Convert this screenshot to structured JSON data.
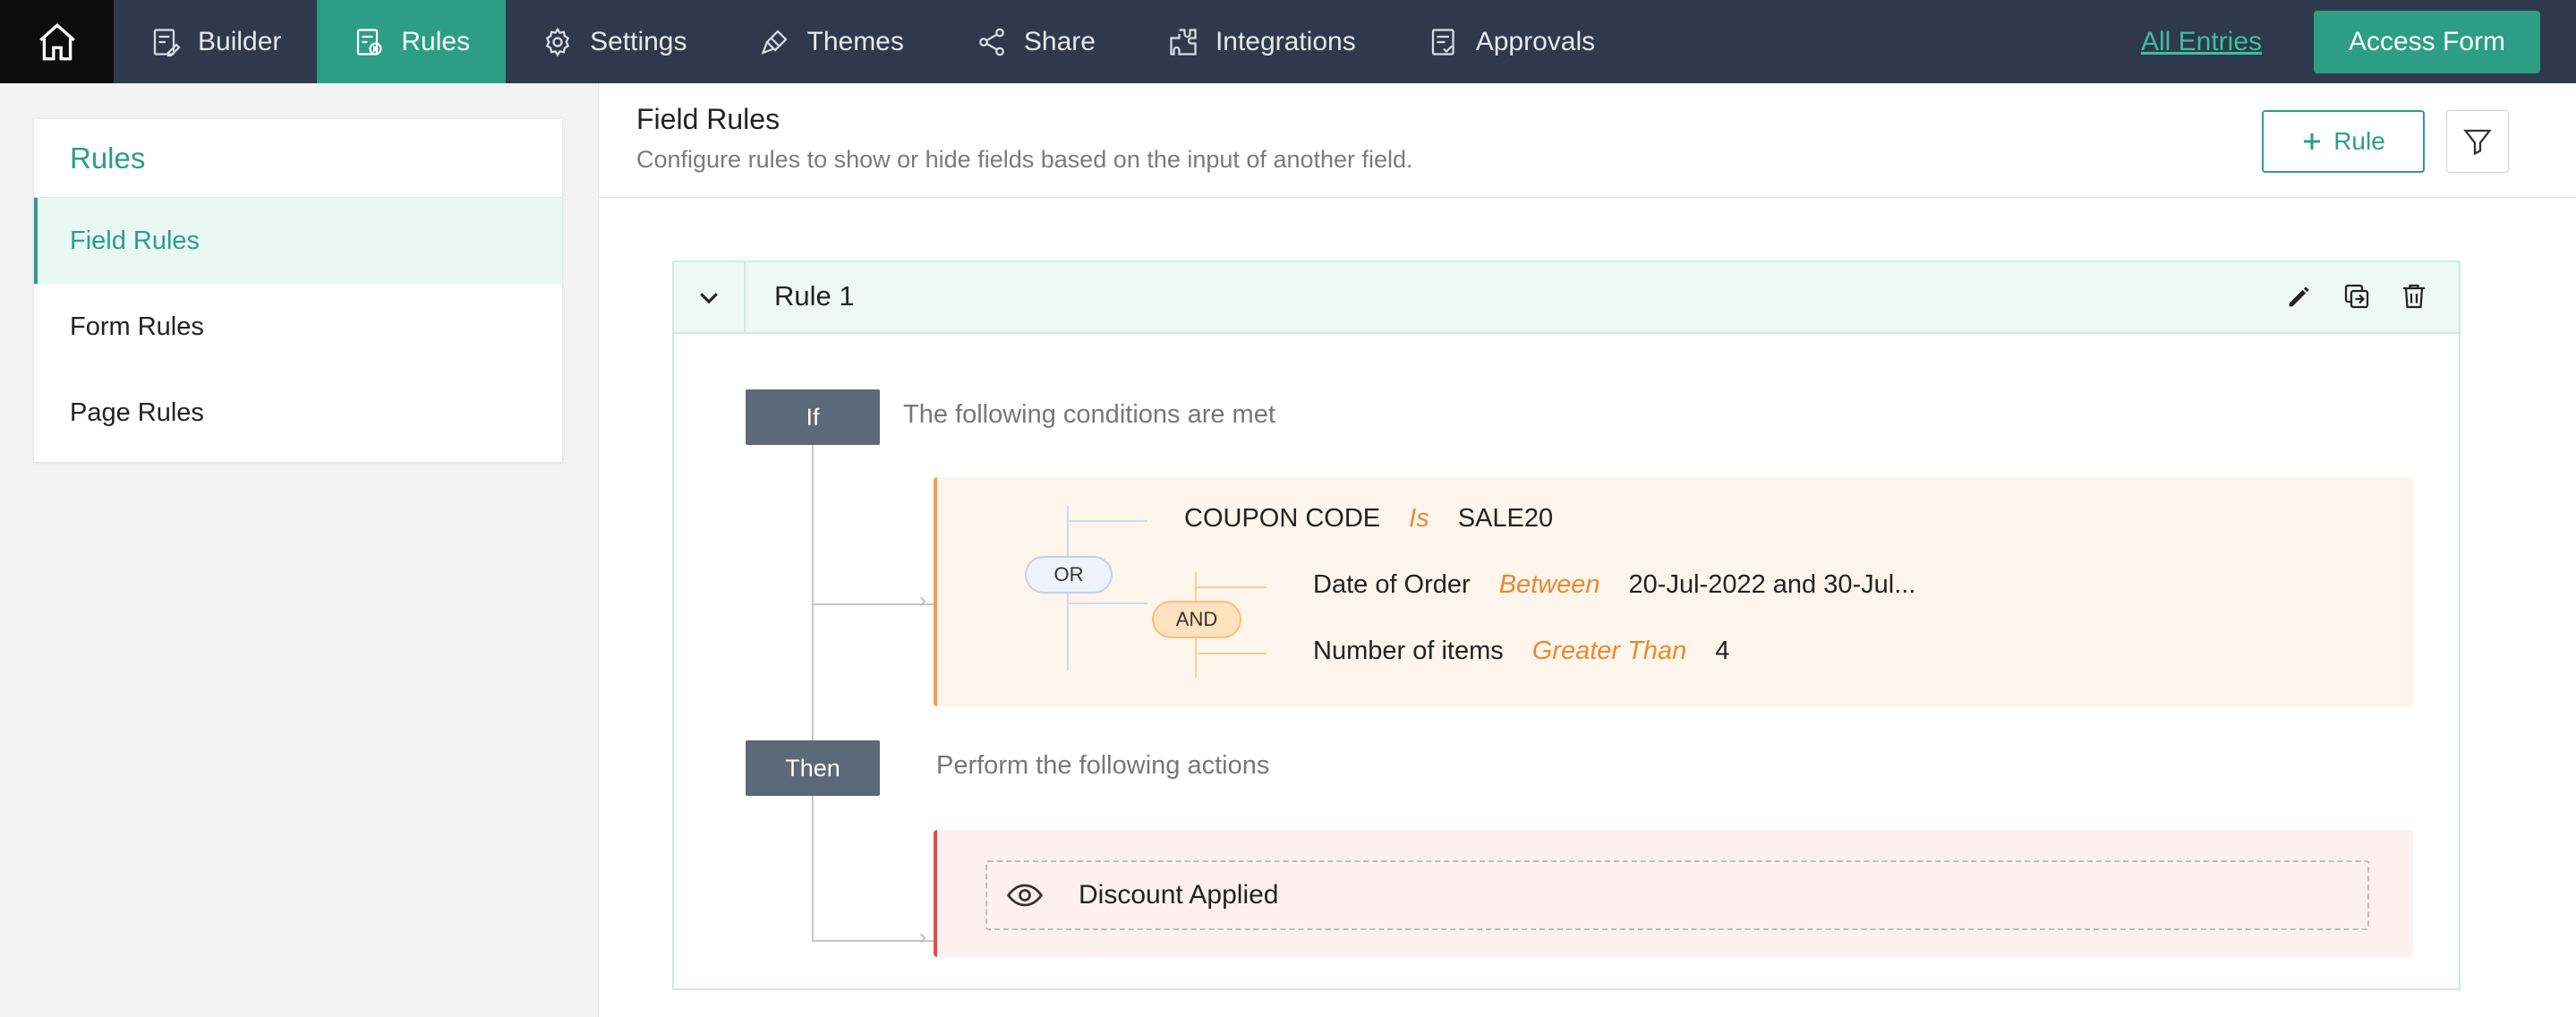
{
  "nav": {
    "items": [
      {
        "label": "Builder",
        "icon": "builder-icon",
        "active": false
      },
      {
        "label": "Rules",
        "icon": "rules-icon",
        "active": true
      },
      {
        "label": "Settings",
        "icon": "gear-icon",
        "active": false
      },
      {
        "label": "Themes",
        "icon": "brush-icon",
        "active": false
      },
      {
        "label": "Share",
        "icon": "share-icon",
        "active": false
      },
      {
        "label": "Integrations",
        "icon": "puzzle-icon",
        "active": false
      },
      {
        "label": "Approvals",
        "icon": "approvals-icon",
        "active": false
      }
    ],
    "all_entries": "All Entries",
    "access_form": "Access Form"
  },
  "sidebar": {
    "title": "Rules",
    "items": [
      {
        "label": "Field Rules",
        "active": true
      },
      {
        "label": "Form Rules",
        "active": false
      },
      {
        "label": "Page Rules",
        "active": false
      }
    ]
  },
  "header": {
    "title": "Field Rules",
    "subtitle": "Configure rules to show or hide fields based on the input of another field.",
    "add_rule_label": "Rule"
  },
  "rule": {
    "name": "Rule 1",
    "if_label": "If",
    "then_label": "Then",
    "conditions_caption": "The following conditions are met",
    "actions_caption": "Perform the following actions",
    "or_label": "OR",
    "and_label": "AND",
    "conditions": [
      {
        "field": "COUPON CODE",
        "operator": "Is",
        "value": "SALE20"
      },
      {
        "field": "Date of Order",
        "operator": "Between",
        "value": "20-Jul-2022 and 30-Jul..."
      },
      {
        "field": "Number of items",
        "operator": "Greater Than",
        "value": "4"
      }
    ],
    "action": {
      "label": "Discount Applied",
      "icon": "eye-icon"
    }
  },
  "colors": {
    "nav_bg": "#2e3a4b",
    "accent": "#2c9e85",
    "operator": "#e98a2c",
    "condition_border": "#f0a048",
    "action_border": "#e94b4b"
  }
}
